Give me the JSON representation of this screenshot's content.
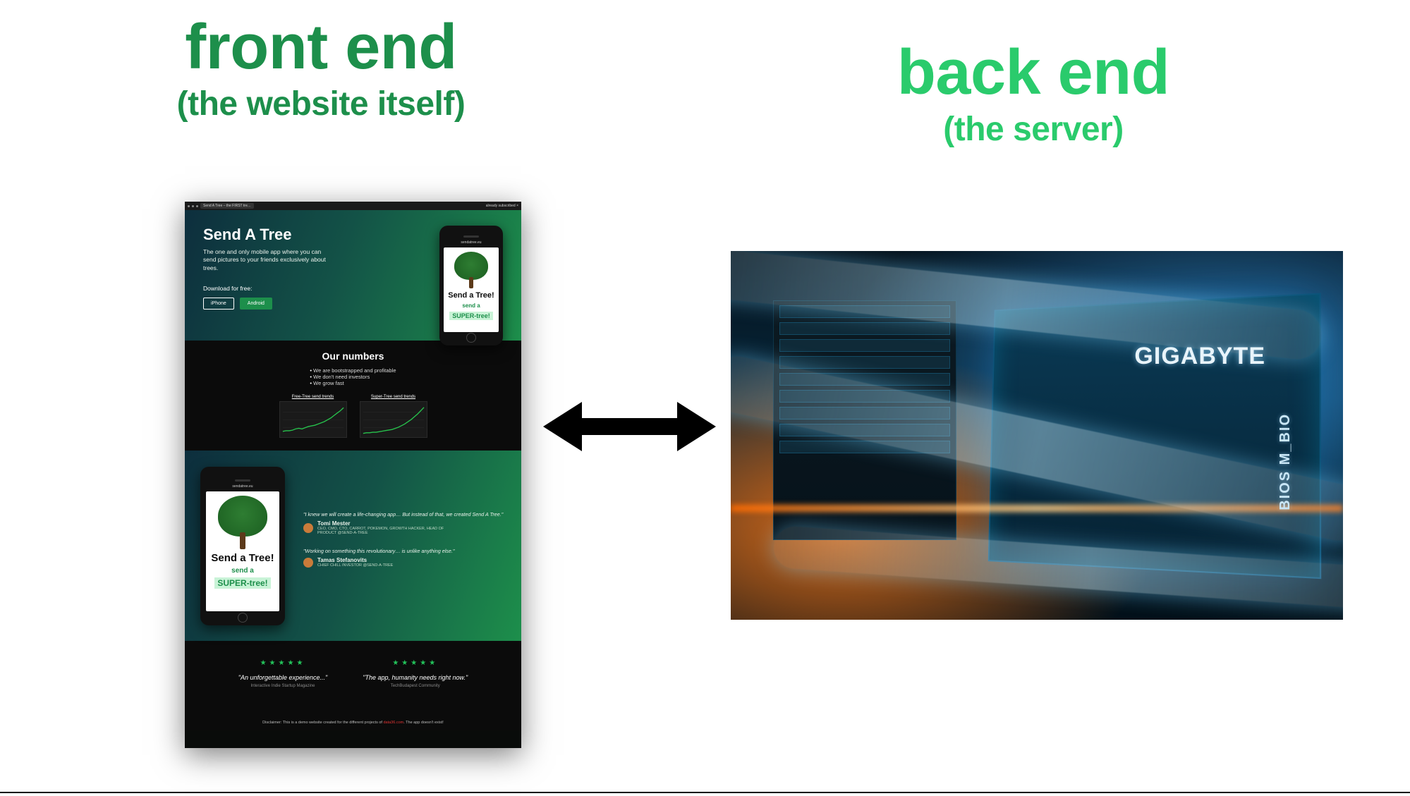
{
  "colors": {
    "frontend_heading": "#1d8f4b",
    "backend_heading": "#2acb6c",
    "accent_green": "#1d8f4b",
    "star_green": "#23c45b"
  },
  "headings": {
    "frontend": {
      "title": "front end",
      "subtitle": "(the website itself)"
    },
    "backend": {
      "title": "back end",
      "subtitle": "(the server)"
    }
  },
  "arrow": {
    "semantic": "bidirectional-arrow"
  },
  "website": {
    "chrome": {
      "tab": "Send A Tree – the FIRST tre…",
      "right_status": "already subscribed ×"
    },
    "hero": {
      "title": "Send A Tree",
      "tagline": "The one and only mobile app where you can send pictures to your friends exclusively about trees.",
      "download_label": "Download for free:",
      "buttons": {
        "iphone": "iPhone",
        "android": "Android"
      },
      "phone": {
        "url": "sendatree.eu",
        "line1": "Send a Tree!",
        "line2": "send a",
        "line3": "SUPER-tree!"
      }
    },
    "numbers": {
      "heading": "Our numbers",
      "bullets": [
        "We are bootstrapped and profitable",
        "We don't need investors",
        "We grow fast"
      ],
      "charts": [
        {
          "title": "Free-Tree send trends"
        },
        {
          "title": "Super-Tree send trends"
        }
      ]
    },
    "quotes": {
      "phone": {
        "url": "sendatree.eu",
        "line1": "Send a Tree!",
        "line2": "send a",
        "line3": "SUPER-tree!"
      },
      "items": [
        {
          "quote": "\"I knew we will create a life-changing app… But instead of that, we created Send A Tree.\"",
          "name": "Tomi Mester",
          "role": "CEO, CMO, CTO, CARROT, POKEMON, GROWTH HACKER, HEAD OF PRODUCT @SEND-A-TREE"
        },
        {
          "quote": "\"Working on something this revolutionary… is unlike anything else.\"",
          "name": "Tamas Stefanovits",
          "role": "CHIEF CHILL INVESTOR @SEND-A-TREE"
        }
      ]
    },
    "reviews": [
      {
        "stars": 5,
        "text": "\"An unforgettable experience...\"",
        "source": "Interactive Indie Startup Magazine"
      },
      {
        "stars": 5,
        "text": "\"The app, humanity needs right now.\"",
        "source": "TechBudapest Community"
      }
    ],
    "disclaimer": {
      "prefix": "Disclaimer: This is a demo website created for the different projects of ",
      "hot": "data36.com",
      "suffix": ". The app doesn't exist!"
    }
  },
  "server_image": {
    "brand_text": "GIGABYTE",
    "bios_text": "BIOS  M_BIO",
    "description": "close-up-of-server-motherboard-with-cooling-tubes"
  },
  "chart_data": [
    {
      "type": "line",
      "title": "Free-Tree send trends",
      "xlabel": "",
      "ylabel": "",
      "x": [
        0,
        1,
        2,
        3,
        4,
        5,
        6,
        7,
        8,
        9,
        10,
        11,
        12,
        13,
        14,
        15,
        16,
        17,
        18,
        19
      ],
      "values": [
        6,
        7,
        7,
        8,
        10,
        11,
        10,
        12,
        14,
        15,
        16,
        18,
        20,
        22,
        25,
        28,
        32,
        36,
        40,
        45
      ],
      "ylim": [
        0,
        50
      ]
    },
    {
      "type": "line",
      "title": "Super-Tree send trends",
      "xlabel": "",
      "ylabel": "",
      "x": [
        0,
        1,
        2,
        3,
        4,
        5,
        6,
        7,
        8,
        9,
        10,
        11,
        12,
        13,
        14,
        15,
        16,
        17,
        18,
        19
      ],
      "values": [
        3,
        4,
        4,
        5,
        5,
        6,
        7,
        8,
        9,
        10,
        12,
        14,
        17,
        20,
        24,
        28,
        33,
        38,
        44,
        50
      ],
      "ylim": [
        0,
        55
      ]
    }
  ]
}
